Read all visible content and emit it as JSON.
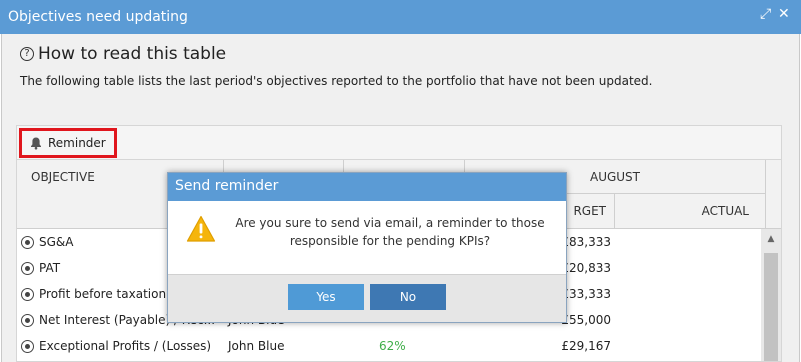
{
  "window": {
    "title": "Objectives need updating",
    "controls": {
      "expand": "⤢",
      "close": "✕"
    }
  },
  "help": {
    "icon": "?",
    "title": "How to read this table",
    "description": "The following table lists the last period's objectives reported to the portfolio that have not been updated."
  },
  "toolbar": {
    "reminder_label": "Reminder"
  },
  "table": {
    "columns": {
      "objective": "OBJECTIVE",
      "month": "AUGUST",
      "target": "RGET",
      "actual": "ACTUAL"
    },
    "rows": [
      {
        "name": "SG&A",
        "owner": "",
        "progress": "",
        "target": "£83,333"
      },
      {
        "name": "PAT",
        "owner": "",
        "progress": "",
        "target": "£20,833"
      },
      {
        "name": "Profit before taxation",
        "owner": "",
        "progress": "",
        "target": "£33,333"
      },
      {
        "name": "Net Interest (Payable) / Rec...",
        "owner": "John Blue",
        "progress": "",
        "target": "£55,000"
      },
      {
        "name": "Exceptional Profits / (Losses)",
        "owner": "John Blue",
        "progress": "62%",
        "target": "£29,167"
      }
    ]
  },
  "dialog": {
    "title": "Send reminder",
    "message": "Are you sure to send via email, a reminder to those responsible for the pending KPIs?",
    "yes_label": "Yes",
    "no_label": "No"
  },
  "colors": {
    "accent": "#5b9bd5",
    "reminder_highlight": "#e0161d",
    "progress_text": "#3fae49",
    "warning": "#f5b50c"
  }
}
